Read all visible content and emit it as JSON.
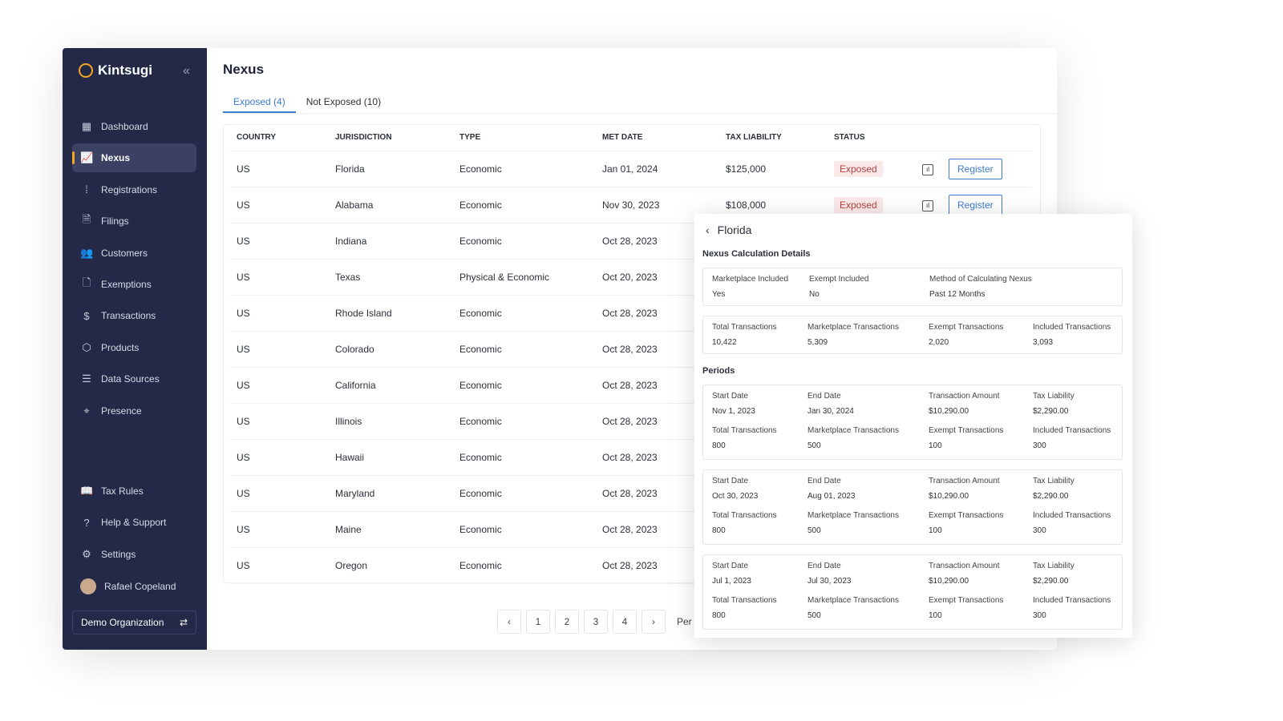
{
  "app": {
    "name": "Kintsugi"
  },
  "sidebar": {
    "items": [
      {
        "label": "Dashboard",
        "icon": "dashboard-icon",
        "glyph": "▦"
      },
      {
        "label": "Nexus",
        "icon": "nexus-chart-icon",
        "glyph": "📈",
        "active": true
      },
      {
        "label": "Registrations",
        "icon": "registrations-icon",
        "glyph": "⁞"
      },
      {
        "label": "Filings",
        "icon": "filings-icon",
        "glyph": "🗎"
      },
      {
        "label": "Customers",
        "icon": "customers-icon",
        "glyph": "👥"
      },
      {
        "label": "Exemptions",
        "icon": "exemptions-icon",
        "glyph": "🗋"
      },
      {
        "label": "Transactions",
        "icon": "transactions-icon",
        "glyph": "$"
      },
      {
        "label": "Products",
        "icon": "products-icon",
        "glyph": "⬡"
      },
      {
        "label": "Data Sources",
        "icon": "database-icon",
        "glyph": "☰"
      },
      {
        "label": "Presence",
        "icon": "location-pin-icon",
        "glyph": "⌖"
      }
    ],
    "bottom": [
      {
        "label": "Tax Rules",
        "icon": "book-icon",
        "glyph": "📖"
      },
      {
        "label": "Help & Support",
        "icon": "help-icon",
        "glyph": "?"
      },
      {
        "label": "Settings",
        "icon": "gear-icon",
        "glyph": "⚙"
      }
    ],
    "user": "Rafael Copeland",
    "org": "Demo Organization"
  },
  "page": {
    "title": "Nexus",
    "tabs": [
      "Exposed (4)",
      "Not Exposed (10)"
    ]
  },
  "table": {
    "headers": [
      "COUNTRY",
      "JURISDICTION",
      "TYPE",
      "MET DATE",
      "TAX LIABILITY",
      "STATUS"
    ],
    "rows": [
      [
        "US",
        "Florida",
        "Economic",
        "Jan 01, 2024",
        "$125,000",
        "Exposed"
      ],
      [
        "US",
        "Alabama",
        "Economic",
        "Nov 30, 2023",
        "$108,000",
        "Exposed"
      ],
      [
        "US",
        "Indiana",
        "Economic",
        "Oct 28, 2023",
        "",
        ""
      ],
      [
        "US",
        "Texas",
        "Physical & Economic",
        "Oct 20, 2023",
        "",
        ""
      ],
      [
        "US",
        "Rhode Island",
        "Economic",
        "Oct 28, 2023",
        "",
        ""
      ],
      [
        "US",
        "Colorado",
        "Economic",
        "Oct 28, 2023",
        "",
        ""
      ],
      [
        "US",
        "California",
        "Economic",
        "Oct 28, 2023",
        "",
        ""
      ],
      [
        "US",
        "Illinois",
        "Economic",
        "Oct 28, 2023",
        "",
        ""
      ],
      [
        "US",
        "Hawaii",
        "Economic",
        "Oct 28, 2023",
        "",
        ""
      ],
      [
        "US",
        "Maryland",
        "Economic",
        "Oct 28, 2023",
        "",
        ""
      ],
      [
        "US",
        "Maine",
        "Economic",
        "Oct 28, 2023",
        "",
        ""
      ],
      [
        "US",
        "Oregon",
        "Economic",
        "Oct 28, 2023",
        "",
        ""
      ]
    ],
    "register_label": "Register"
  },
  "pagination": {
    "pages": [
      "1",
      "2",
      "3",
      "4"
    ],
    "per_page_label": "Per"
  },
  "panel": {
    "title": "Florida",
    "section1": "Nexus Calculation Details",
    "settings": [
      [
        "Marketplace Included",
        "Yes"
      ],
      [
        "Exempt Included",
        "No"
      ],
      [
        "Method of Calculating Nexus",
        "Past 12 Months"
      ]
    ],
    "totals": [
      [
        "Total Transactions",
        "10,422"
      ],
      [
        "Marketplace Transactions",
        "5,309"
      ],
      [
        "Exempt Transactions",
        "2,020"
      ],
      [
        "Included Transactions",
        "3,093"
      ]
    ],
    "section2": "Periods",
    "periods": [
      [
        [
          "Start Date",
          "Nov 1, 2023"
        ],
        [
          "End Date",
          "Jan 30, 2024"
        ],
        [
          "Transaction Amount",
          "$10,290.00"
        ],
        [
          "Tax Liability",
          "$2,290.00"
        ],
        [
          "Total Transactions",
          "800"
        ],
        [
          "Marketplace Transactions",
          "500"
        ],
        [
          "Exempt Transactions",
          "100"
        ],
        [
          "Included Transactions",
          "300"
        ]
      ],
      [
        [
          "Start Date",
          "Oct 30, 2023"
        ],
        [
          "End Date",
          "Aug 01, 2023"
        ],
        [
          "Transaction Amount",
          "$10,290.00"
        ],
        [
          "Tax Liability",
          "$2,290.00"
        ],
        [
          "Total Transactions",
          "800"
        ],
        [
          "Marketplace Transactions",
          "500"
        ],
        [
          "Exempt Transactions",
          "100"
        ],
        [
          "Included Transactions",
          "300"
        ]
      ],
      [
        [
          "Start Date",
          "Jul 1, 2023"
        ],
        [
          "End Date",
          "Jul 30, 2023"
        ],
        [
          "Transaction Amount",
          "$10,290.00"
        ],
        [
          "Tax Liability",
          "$2,290.00"
        ],
        [
          "Total Transactions",
          "800"
        ],
        [
          "Marketplace Transactions",
          "500"
        ],
        [
          "Exempt Transactions",
          "100"
        ],
        [
          "Included Transactions",
          "300"
        ]
      ]
    ]
  },
  "colors": {
    "sidebar": "#232946",
    "accent": "#3d7bd1",
    "brand": "#f2a623",
    "exposed": "#b0413e"
  }
}
